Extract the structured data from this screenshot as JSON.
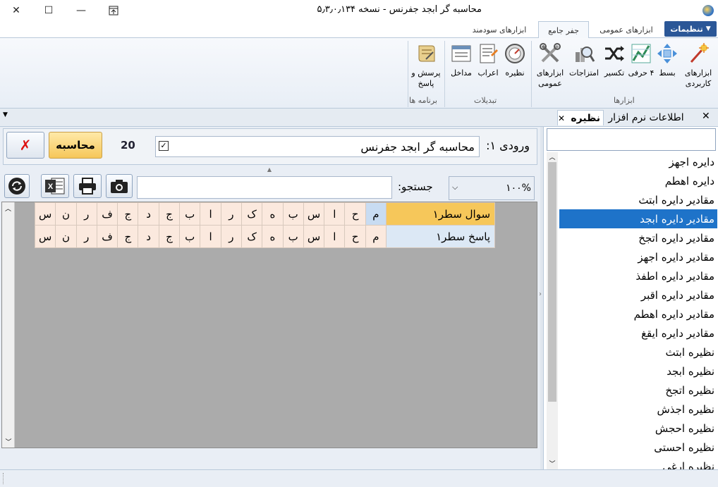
{
  "window": {
    "title": "محاسبه گر ابجد جفرنس - نسخه ۵٫۳٫۰٫۱۳۴"
  },
  "ribbon_tabs": [
    {
      "label": "تنظیمات"
    },
    {
      "label": "ابزارهای عمومی"
    },
    {
      "label": "جفر جامع"
    },
    {
      "label": "ابزارهای سودمند"
    }
  ],
  "ribbon": {
    "group_tools": {
      "label": "ابزارها",
      "buttons": [
        {
          "label": "ابزارهای کاربردی",
          "icon": "wand-icon"
        },
        {
          "label": "بسط",
          "icon": "expand-icon"
        },
        {
          "label": "۴ حرفی",
          "icon": "chart-icon"
        },
        {
          "label": "تکسیر",
          "icon": "shuffle-icon"
        },
        {
          "label": "امتزاجات",
          "icon": "magnifier-icon"
        },
        {
          "label": "ابزارهای عمومی",
          "icon": "tools-icon"
        }
      ]
    },
    "group_conversions": {
      "label": "تبدیلات",
      "buttons": [
        {
          "label": "نظیره",
          "icon": "dial-icon"
        },
        {
          "label": "اعراب",
          "icon": "document-icon"
        },
        {
          "label": "مداخل",
          "icon": "form-icon"
        }
      ]
    },
    "group_programs": {
      "label": "برنامه ها",
      "buttons": [
        {
          "label": "پرسش و پاسخ",
          "icon": "scroll-icon"
        }
      ]
    }
  },
  "dock_tabs": {
    "right": {
      "label": "نظیره"
    },
    "left": {
      "label": "اطلاعات نرم افزار"
    }
  },
  "input": {
    "label": "ورودی ۱:",
    "value": "محاسبه گر ابجد جفرنس",
    "count": "20",
    "calc_button": "محاسبه"
  },
  "search": {
    "label": "جستجو:",
    "value": "",
    "zoom": "۱۰۰%"
  },
  "grid": {
    "rows": [
      {
        "label": "سوال سطر۱",
        "cells": [
          "م",
          "ح",
          "ا",
          "س",
          "ب",
          "ه",
          "ک",
          "ر",
          "ا",
          "ب",
          "ج",
          "د",
          "ج",
          "ف",
          "ر",
          "ن",
          "س"
        ]
      },
      {
        "label": "پاسخ سطر۱",
        "cells": [
          "م",
          "ح",
          "ا",
          "س",
          "ب",
          "ه",
          "ک",
          "ر",
          "ا",
          "ب",
          "ج",
          "د",
          "ج",
          "ف",
          "ر",
          "ن",
          "س"
        ]
      }
    ]
  },
  "right_list": {
    "search_value": "",
    "items": [
      "دایره اجهز",
      "دایره اهطم",
      "مقادیر دایره ابتث",
      "مقادیر دایره ابجد",
      "مقادیر دایره اتجخ",
      "مقادیر دایره اجهز",
      "مقادیر دایره اطفذ",
      "مقادیر دایره اقبر",
      "مقادیر دایره اهطم",
      "مقادیر دایره ایقغ",
      "نظیره ابتث",
      "نظیره ابجد",
      "نظیره اتجخ",
      "نظیره اجذش",
      "نظیره احجش",
      "نظیره احستی",
      "نظیره ارغی"
    ],
    "selected_index": 3
  },
  "colors": {
    "accent": "#1e73c9",
    "settings_tab": "#2b5797",
    "row_header": "#f6c75a",
    "cell_bg": "#fbe9de"
  }
}
